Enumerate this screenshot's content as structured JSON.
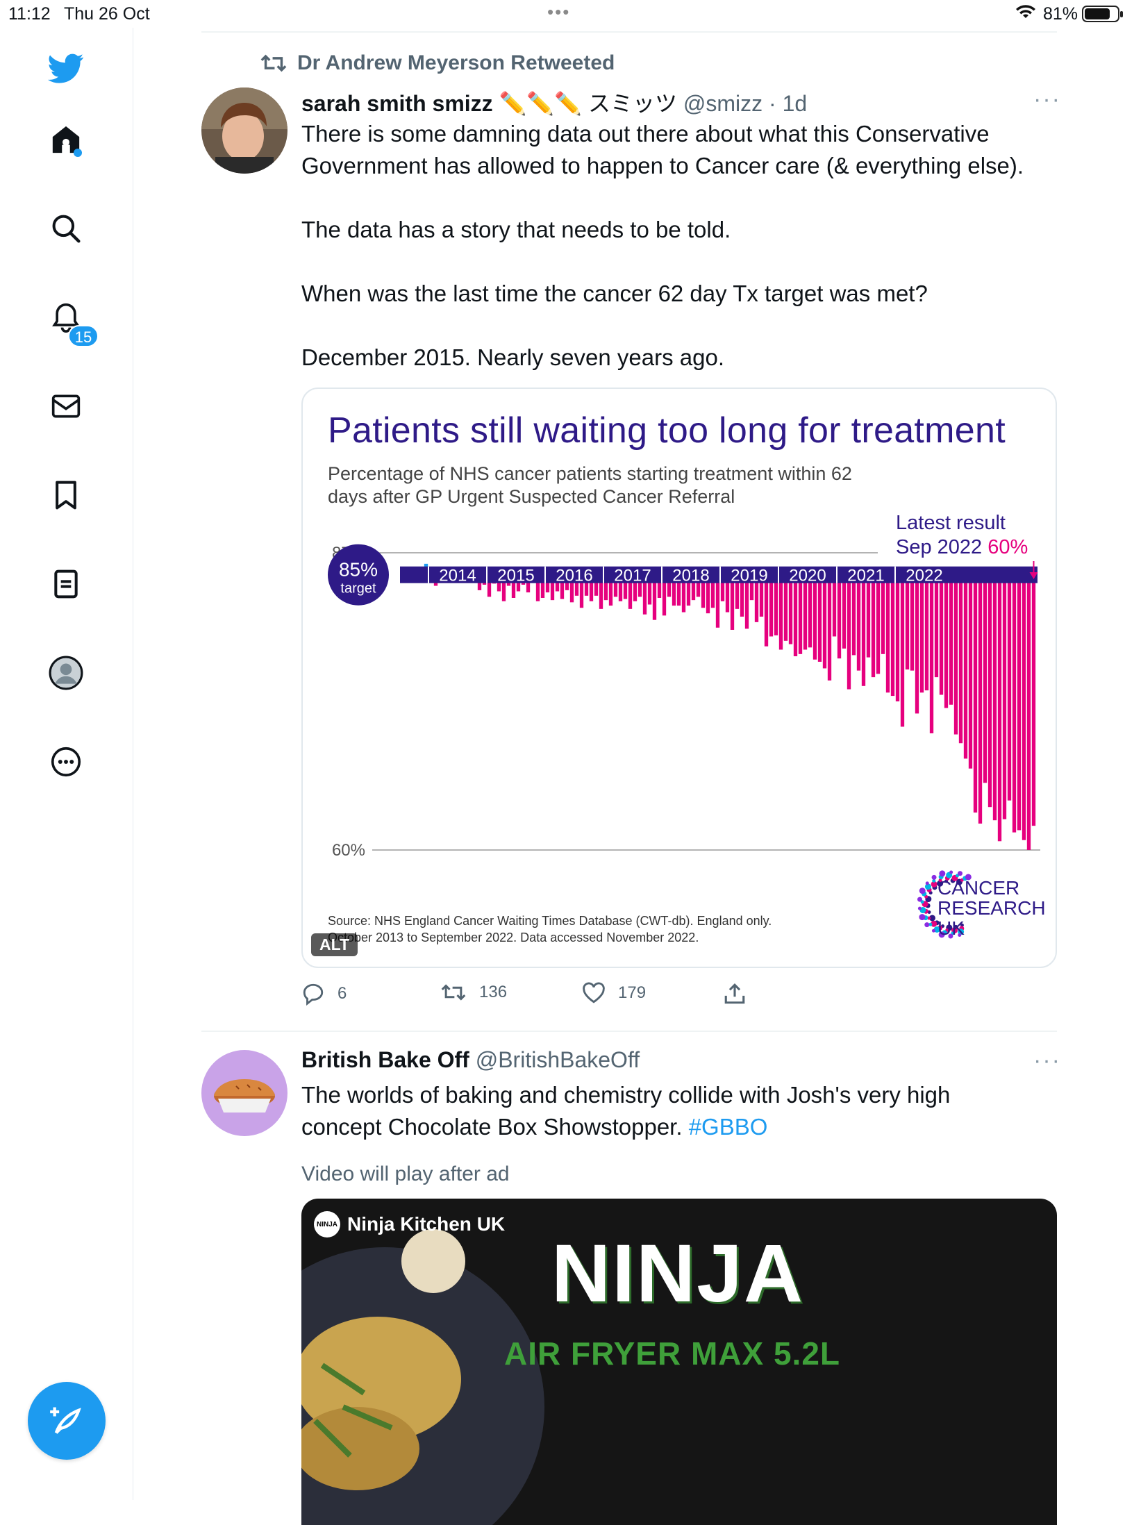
{
  "status_bar": {
    "time": "11:12",
    "date": "Thu 26 Oct",
    "battery": "81%"
  },
  "sidebar": {
    "notifications_count": "15"
  },
  "tweet1": {
    "retweet_label": "Dr Andrew Meyerson Retweeted",
    "display_name": "sarah smith smizz",
    "name_emoji": "✏️✏️✏️ スミッツ",
    "handle": "@smizz",
    "time": "· 1d",
    "text": [
      "There is some damning data out there about what this Conservative Government has allowed to happen to Cancer care (& everything else).",
      "The data has a story that needs to be told.",
      "When was the last time the cancer 62 day Tx target was met?",
      "December 2015. Nearly seven years ago."
    ],
    "alt_badge": "ALT",
    "actions": {
      "replies": "6",
      "retweets": "136",
      "likes": "179"
    }
  },
  "chart_card": {
    "title": "Patients still waiting too long for treatment",
    "subtitle": "Percentage of NHS cancer patients starting treatment within 62 days after GP Urgent Suspected Cancer Referral",
    "latest_label": "Latest result",
    "latest_period": "Sep 2022",
    "latest_value": "60%",
    "target_value": "85%",
    "target_label": "target",
    "source": "Source: NHS England Cancer Waiting Times Database (CWT-db). England only. October 2013 to September 2022. Data accessed November 2022.",
    "brand": [
      "CANCER",
      "RESEARCH",
      "UK"
    ],
    "colors": {
      "title": "#2e1a87",
      "bars": "#e6007e",
      "above_target": "#1d9bf0",
      "band": "#2e1a87"
    }
  },
  "chart_data": {
    "type": "bar",
    "title": "Patients still waiting too long for treatment",
    "ylabel": "",
    "y_ticks": [
      "87%",
      "60%"
    ],
    "ylim": [
      60,
      87
    ],
    "target": 85,
    "x_period_labels": [
      "2014",
      "2015",
      "2016",
      "2017",
      "2018",
      "2019",
      "2020",
      "2021",
      "2022"
    ],
    "series": [
      {
        "values": [
          85.3,
          85.2,
          86.0,
          84.4,
          84.0,
          85.1,
          84.7,
          85.4,
          84.5,
          85.3,
          84.7,
          85.0,
          84.4,
          83.6,
          84.1,
          83.0,
          84.2,
          83.5,
          82.6,
          84.0,
          82.9,
          83.5,
          84.1,
          83.4,
          85.1,
          82.6,
          82.9,
          83.4,
          82.7,
          83.5,
          82.8,
          83.6,
          82.5,
          83.1,
          82.0,
          83.1,
          82.6,
          83.1,
          81.9,
          82.7,
          82.2,
          83.0,
          82.6,
          82.8,
          81.9,
          82.6,
          83.0,
          81.4,
          82.3,
          80.9,
          82.9,
          81.3,
          83.0,
          82.2,
          82.2,
          81.6,
          82.2,
          82.7,
          83.0,
          82.0,
          81.5,
          82.0,
          80.2,
          82.6,
          81.6,
          80.0,
          81.9,
          81.2,
          80.1,
          82.7,
          80.7,
          81.2,
          78.5,
          79.4,
          79.5,
          78.2,
          79.0,
          78.7,
          77.6,
          77.8,
          78.2,
          78.4,
          77.3,
          77.1,
          76.5,
          75.4,
          79.4,
          77.4,
          78.3,
          74.6,
          77.7,
          76.3,
          74.9,
          77.5,
          75.7,
          76.0,
          77.8,
          74.3,
          74.0,
          73.5,
          71.2,
          76.4,
          76.3,
          72.4,
          74.3,
          74.5,
          70.6,
          75.7,
          74.1,
          72.9,
          73.2,
          70.5,
          69.7,
          68.3,
          67.4,
          63.4,
          62.4,
          66.1,
          63.9,
          62.7,
          60.8,
          62.8,
          64.5,
          61.6,
          61.8,
          60.9,
          60.0,
          62.2
        ]
      }
    ],
    "legend": "none"
  },
  "tweet2": {
    "display_name": "British Bake Off",
    "handle": "@BritishBakeOff",
    "text": "The worlds of baking and chemistry collide with Josh's very high concept Chocolate Box Showstopper.",
    "hashtag": "#GBBO",
    "video_note": "Video will play after ad",
    "ad_source": "Ninja Kitchen UK",
    "ad_logo_text": "NINJA",
    "ad_brand": "NINJA",
    "ad_product": "AIR FRYER MAX 5.2L"
  }
}
